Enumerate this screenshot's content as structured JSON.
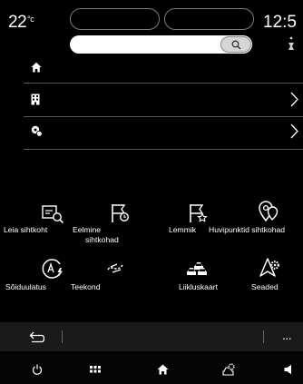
{
  "status": {
    "temperature": "22",
    "temperature_unit": "°c",
    "time": "12:5"
  },
  "search": {
    "placeholder": ""
  },
  "menu_rows": [
    {
      "icon": "home-icon"
    },
    {
      "icon": "building-icon"
    },
    {
      "icon": "recent-destination-icon"
    }
  ],
  "grid": [
    {
      "icon": "find-destination-icon",
      "label": "Leia sihtkoht"
    },
    {
      "icon": "previous-destinations-icon",
      "label_line1": "Eelmine",
      "label_line2": "sihtkohad"
    },
    {
      "icon": "favorites-icon",
      "label": "Lemmik"
    },
    {
      "icon": "poi-icon",
      "label": "Huvipunktid sihtkohad"
    },
    {
      "icon": "charging-route-icon",
      "label": "Sõiduulatus"
    },
    {
      "icon": "route-icon",
      "label": "Teekond"
    },
    {
      "icon": "traffic-map-icon",
      "label": "Liikluskaart"
    },
    {
      "icon": "settings-icon",
      "label": "Seaded"
    }
  ],
  "back_bar": {
    "more_label": "..."
  },
  "nav_bar": {
    "icons": [
      "power-icon",
      "apps-grid-icon",
      "home-icon",
      "settings-car-icon",
      "volume-icon"
    ]
  }
}
